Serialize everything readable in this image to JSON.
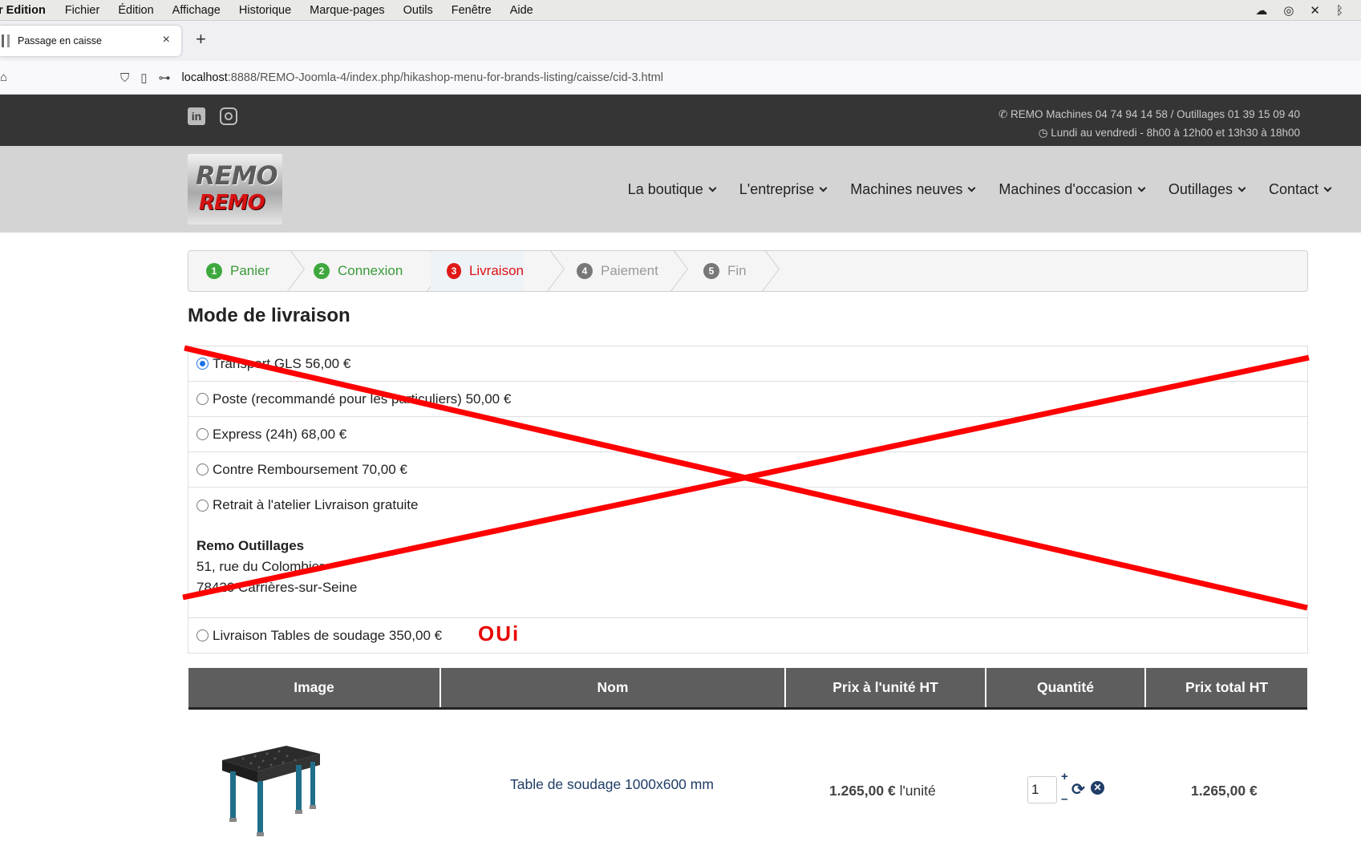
{
  "menubar": {
    "app": "r Edition",
    "items": [
      "Fichier",
      "Édition",
      "Affichage",
      "Historique",
      "Marque-pages",
      "Outils",
      "Fenêtre",
      "Aide"
    ]
  },
  "tab": {
    "title": "Passage en caisse",
    "close": "×",
    "new": "+"
  },
  "url": {
    "host": "localhost",
    "rest": ":8888/REMO-Joomla-4/index.php/hikashop-menu-for-brands-listing/caisse/cid-3.html"
  },
  "topbar": {
    "phone": "REMO Machines 04 74 94 14 58 / Outillages 01 39 15 09 40",
    "hours": "Lundi au vendredi - 8h00 à 12h00 et 13h30 à 18h00"
  },
  "logo": {
    "line1": "REMO",
    "line2": "REMO"
  },
  "nav": [
    "La boutique",
    "L'entreprise",
    "Machines neuves",
    "Machines d'occasion",
    "Outillages",
    "Contact"
  ],
  "steps": [
    {
      "num": "1",
      "label": "Panier"
    },
    {
      "num": "2",
      "label": "Connexion"
    },
    {
      "num": "3",
      "label": "Livraison"
    },
    {
      "num": "4",
      "label": "Paiement"
    },
    {
      "num": "5",
      "label": "Fin"
    }
  ],
  "section_title": "Mode de livraison",
  "shipping": {
    "options": [
      "Transport GLS 56,00 €",
      "Poste (recommandé pour les particuliers) 50,00 €",
      "Express (24h) 68,00 €",
      "Contre Remboursement 70,00 €",
      "Retrait à l'atelier Livraison gratuite"
    ],
    "address": {
      "company": "Remo Outillages",
      "street": "51, rue du Colombier",
      "city": "78420 Carrières-sur-Seine"
    },
    "last_option": "Livraison Tables de soudage 350,00 €",
    "annotation": "OUi",
    "selected_index": 0
  },
  "cart": {
    "headers": [
      "Image",
      "Nom",
      "Prix à l'unité HT",
      "Quantité",
      "Prix total HT"
    ],
    "row": {
      "name": "Table de soudage 1000x600 mm",
      "unit_price": "1.265,00 €",
      "unit_suffix": " l'unité",
      "quantity": "1",
      "plus": "+",
      "minus": "–",
      "total": "1.265,00 €"
    }
  }
}
